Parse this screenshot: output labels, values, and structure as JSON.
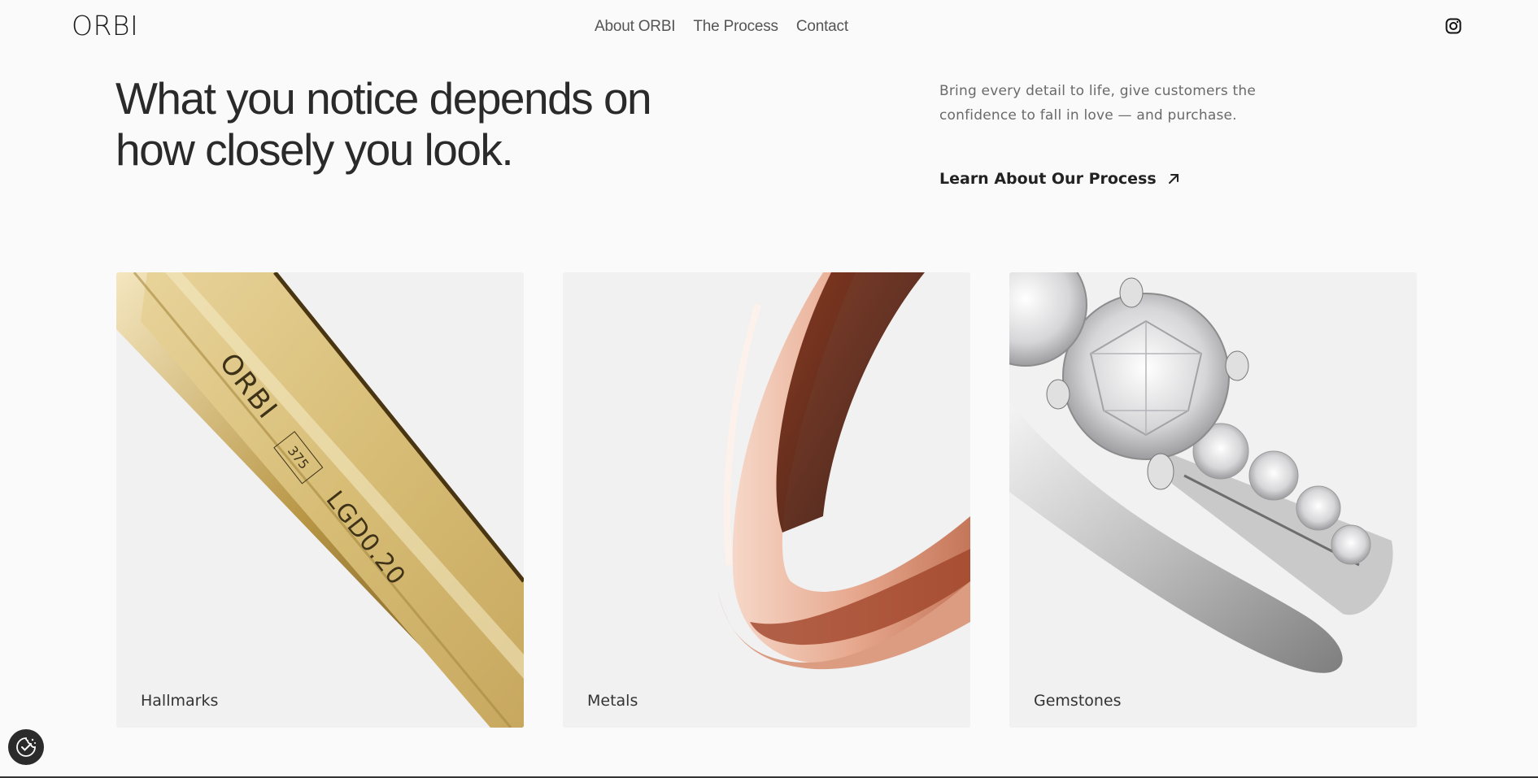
{
  "header": {
    "logo": "ORBI",
    "nav": [
      {
        "label": "About ORBI"
      },
      {
        "label": "The Process"
      },
      {
        "label": "Contact"
      }
    ],
    "social_icon": "instagram-icon"
  },
  "hero": {
    "headline_line1": "What you notice depends on",
    "headline_line2": "how closely you look.",
    "subtitle": "Bring every detail to life, give customers the confidence to fall in love — and purchase.",
    "cta_label": "Learn About Our Process",
    "cta_icon": "arrow-up-right-icon"
  },
  "cards": [
    {
      "label": "Hallmarks",
      "engraving": {
        "brand": "ORBI",
        "karat": "375",
        "stone": "LGD0.20"
      }
    },
    {
      "label": "Metals"
    },
    {
      "label": "Gemstones"
    }
  ],
  "colors": {
    "background": "#fafafa",
    "card_background": "#f1f1f1",
    "gold": "#d9bf7a",
    "rose_gold": "#e9b199",
    "silver": "#d8d8d8",
    "text_dark": "#222222",
    "text_muted": "#6a6a6a"
  },
  "cookie_button_icon": "cookie-consent-icon"
}
